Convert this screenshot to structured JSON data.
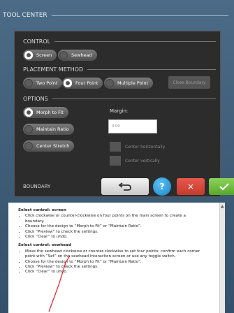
{
  "window_title": "TOOL CENTER",
  "control": {
    "heading": "CONTROL",
    "options": [
      {
        "label": "Screen",
        "selected": true
      },
      {
        "label": "Sewhead",
        "selected": false
      }
    ]
  },
  "placement": {
    "heading": "PLACEMENT METHOD",
    "options": [
      {
        "label": "Two Point",
        "selected": false
      },
      {
        "label": "Four Point",
        "selected": true
      },
      {
        "label": "Multiple Point",
        "selected": false
      }
    ],
    "close_boundary_label": "Close Boundary"
  },
  "options": {
    "heading": "OPTIONS",
    "modes": [
      {
        "label": "Morph to Fit",
        "selected": true
      },
      {
        "label": "Maintain Ratio",
        "selected": false
      },
      {
        "label": "Center Stretch",
        "selected": false
      }
    ],
    "margin_label": "Margin:",
    "margin_value": "0.00",
    "center_horizontally_label": "Center horizontally",
    "center_vertically_label": "Center vertically"
  },
  "boundary": {
    "label": "BOUNDARY",
    "help_label": "?",
    "clear_label": "×"
  },
  "help": {
    "screen_heading": "Select control: screen",
    "screen_items": [
      "Click clockwise or counter-clockwise on four points on the main screen to create a boundary.",
      "Choose for the design to “Morph to Fit” or “Maintain Ratio”.",
      "Click “Preview” to check the settings.",
      "Click “Clear” to undo."
    ],
    "sewhead_heading": "Select control: sewhead",
    "sewhead_items": [
      "Move the sewhead clockwise or counter-clockwise to set four points; confirm each corner point with “Set” on the sewhead interaction screen or use any toggle switch.",
      "Choose for the design to “Morph to Fit” or “Maintain Ratio”.",
      "Click “Preview” to check the settings.",
      "Click “Clear” to undo."
    ]
  },
  "colors": {
    "help_button": "#1684c9",
    "clear_button": "#d9473b",
    "ok_button": "#6fbe3e",
    "annotation_stroke": "#e0202a"
  }
}
